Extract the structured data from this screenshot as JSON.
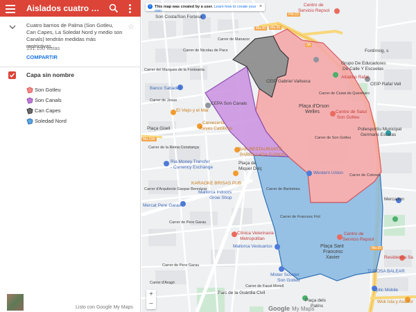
{
  "header": {
    "title": "Aislados cuatro barrios de Palma",
    "menu_icon": "hamburger-menu-icon",
    "search_icon": "search-icon",
    "more_icon": "more-vert-icon",
    "bar_color": "#db4437"
  },
  "details": {
    "description": "Cuatro barrios de Palma (Son Gotleu, Can Capes, La Soledat Nord y medio son Canals) tendrán medidas más restrictivas.",
    "views": "131.150 vistas",
    "share_label": "COMPARTIR",
    "star_icon": "star-outline-icon"
  },
  "layer": {
    "name": "Capa sin nombre",
    "checked": true,
    "features": [
      {
        "label": "Son Gotleu",
        "color": "#f28b8b",
        "icon": "polygon-icon"
      },
      {
        "label": "Son Canals",
        "color": "#c27ad6",
        "icon": "polygon-icon"
      },
      {
        "label": "Can Capes",
        "color": "#4d4d4d",
        "icon": "polygon-icon"
      },
      {
        "label": "Soledad Nord",
        "color": "#5aa6dd",
        "icon": "polygon-icon"
      }
    ]
  },
  "footer": {
    "text": "Listo con Google My Maps"
  },
  "map": {
    "notice": {
      "bold": "This map was created by a user.",
      "link": "Learn how to create your own."
    },
    "zoom_in": "+",
    "zoom_out": "−",
    "google_logo": "Google",
    "mymaps_logo": "My Maps",
    "polygons": [
      {
        "name": "Son Gotleu",
        "fill": "#f4a9aa",
        "stroke": "#d85a5f"
      },
      {
        "name": "Son Canals",
        "fill": "#c98fe0",
        "stroke": "#8b4fb0"
      },
      {
        "name": "Can Capes",
        "fill": "#8a8a8a",
        "stroke": "#3b3b3b"
      },
      {
        "name": "Soledad Nord",
        "fill": "#86b8e2",
        "stroke": "#2e6fb5"
      }
    ],
    "labels": {
      "l1": "Son Costa/Son Fortesa",
      "l2": "Centro de",
      "l3": "Servicio Repsol",
      "l4": "Fontirroig, s",
      "l5": "Grupo De Educadores",
      "l6": "De Calle Y Escuelas",
      "l7": "Alcatico Rafal",
      "l8": "CEIP Rafal Vell",
      "l9": "Banco Sabadell",
      "l10": "CEIP Gabriel Vallseca",
      "l11": "El Viejo y el Mar",
      "l12": "CEPA Son Canals",
      "l13": "Plaça d'Orson",
      "l14": "Welles",
      "l15": "Centre de Salut",
      "l16": "Son Gotleu",
      "l17": "Cervecería",
      "l18": "Reyes Católicos",
      "l19": "Poliesportiu Municipal",
      "l20": "Germans Escalas",
      "l21": "Plaça Güell",
      "l22": "BAR RESTAURANTE",
      "l23": "PARRILLADA FUSION",
      "l24": "Ria Money Transfer",
      "l25": "- Currency Exchange",
      "l26": "Plaça de",
      "l27": "Miquel Dolç",
      "l28": "Western Union",
      "l29": "KARAOKE BRISAS PUB",
      "l30": "Mallorca Indoors",
      "l31": "Grow Shop",
      "l32": "Mercat Pere Garau",
      "l33": "Mercadon",
      "l34": "Carrer de Pere Garau",
      "l35": "Clínica Veterinaria",
      "l36": "Metropolitan",
      "l37": "Centro de",
      "l38": "Servicio Repsol",
      "l39": "Mallorca Vestuarios",
      "l40": "Plaça Sant",
      "l41": "Francesc",
      "l42": "Xavier",
      "l43": "Residencia Sa",
      "l44": "TUBOSA BALEAR",
      "l45": "Mister Scooter",
      "l46": "Son Gotleu",
      "l47": "Parc de la Guàrdia Civil",
      "l48": "Optic Mobile",
      "l49": "Plaça dels",
      "l50": "Patins",
      "l51": "Wok Isla y Asador",
      "l52": "Ma-30",
      "l53": "Ma-13A",
      "l54": "Ma-20",
      "l55": "PM-23",
      "l56": "Ma-30",
      "l57": "Carrer de Manacor",
      "l58": "Carrer del Marquès de la Fontsanta",
      "l59": "Carrer de Son Gotleu",
      "l60": "Carrer de Pere Garau",
      "l61": "Carrer de Bartomeu",
      "l62": "Carrer de Nicolau de Pacs",
      "l63": "Carrer de Faust Morell",
      "l64": "Carrer de Jesús",
      "l65": "Carrer d'Arquitecte Gaspar Bennàzar",
      "l66": "Carrer de la Reina Constança",
      "l67": "Carrer de Francesc Fiol",
      "l68": "Carrer de Cotoner",
      "l69": "Carrer d'Aragó",
      "l70": "Carrer de Ciutat de Querétaro",
      "l71": "3A"
    }
  }
}
